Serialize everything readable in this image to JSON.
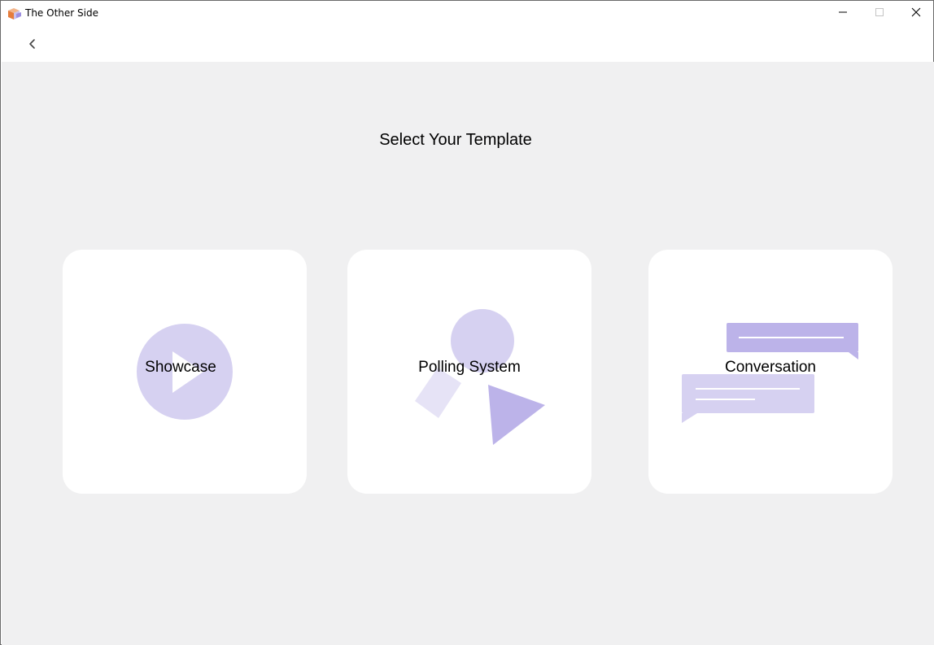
{
  "window": {
    "title": "The Other Side",
    "minimize_icon": "minimize-icon",
    "maximize_icon": "maximize-icon",
    "close_icon": "close-icon"
  },
  "nav": {
    "back_icon": "chevron-left-icon"
  },
  "page": {
    "title": "Select Your Template"
  },
  "templates": [
    {
      "label": "Showcase",
      "icon": "play-icon"
    },
    {
      "label": "Polling System",
      "icon": "shapes-icon"
    },
    {
      "label": "Conversation",
      "icon": "chat-bubbles-icon"
    }
  ],
  "colors": {
    "background": "#f0f0f1",
    "card": "#ffffff",
    "accent_light": "#d6d1f1",
    "accent_lighter": "#e6e3f6",
    "accent_mid": "#bcb3e9"
  }
}
